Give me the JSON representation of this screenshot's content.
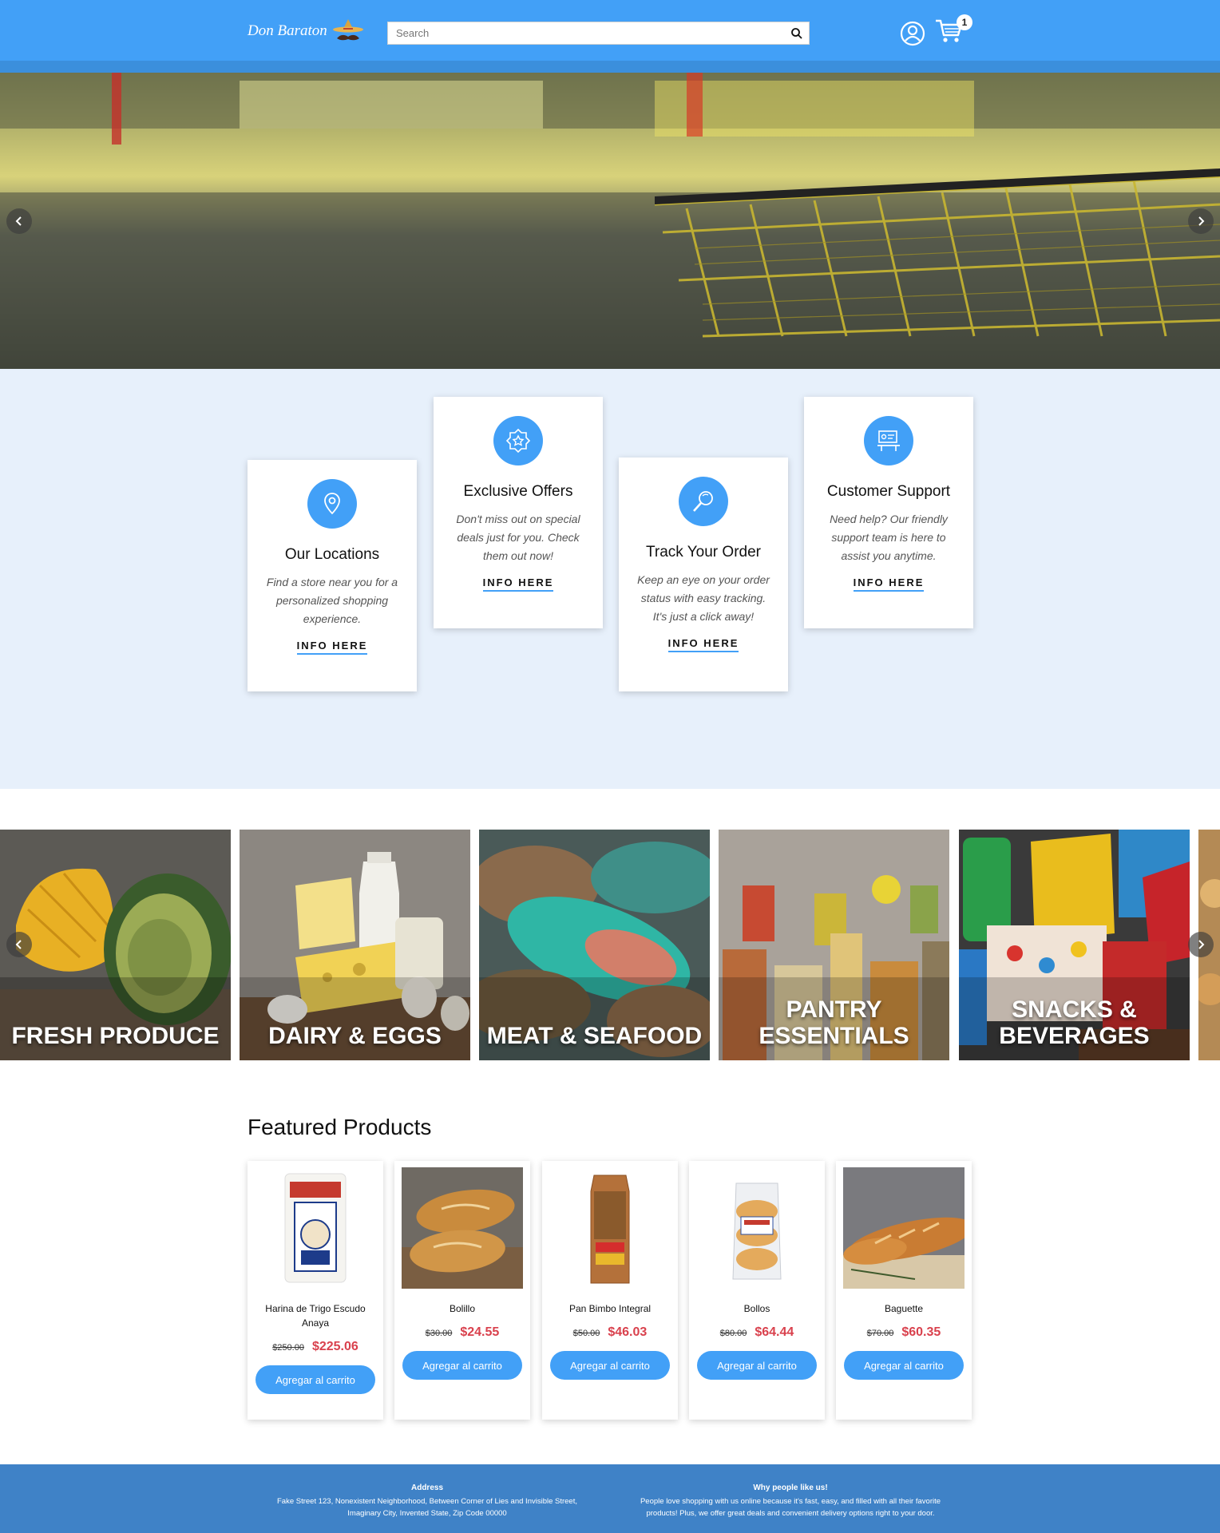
{
  "header": {
    "logo_text": "Don Baraton",
    "search_placeholder": "Search",
    "cart_count": "1"
  },
  "services": [
    {
      "title": "Our Locations",
      "description": "Find a store near you for a personalized shopping experience.",
      "link": "INFO HERE",
      "icon": "location-pin-icon"
    },
    {
      "title": "Exclusive Offers",
      "description": "Don't miss out on special deals just for you. Check them out now!",
      "link": "INFO HERE",
      "icon": "badge-icon"
    },
    {
      "title": "Track Your Order",
      "description": "Keep an eye on your order status with easy tracking. It's just a click away!",
      "link": "INFO HERE",
      "icon": "magnifier-icon"
    },
    {
      "title": "Customer Support",
      "description": "Need help? Our friendly support team is here to assist you anytime.",
      "link": "INFO HERE",
      "icon": "support-desk-icon"
    }
  ],
  "categories": [
    {
      "label": "FRESH PRODUCE"
    },
    {
      "label": "DAIRY & EGGS"
    },
    {
      "label": "MEAT & SEAFOOD"
    },
    {
      "label": "PANTRY ESSENTIALS"
    },
    {
      "label": "SNACKS & BEVERAGES"
    }
  ],
  "featured": {
    "title": "Featured Products",
    "products": [
      {
        "name": "Harina de Trigo Escudo Anaya",
        "old_price": "$250.00",
        "price": "$225.06",
        "button": "Agregar al carrito"
      },
      {
        "name": "Bolillo",
        "old_price": "$30.00",
        "price": "$24.55",
        "button": "Agregar al carrito"
      },
      {
        "name": "Pan Bimbo Integral",
        "old_price": "$50.00",
        "price": "$46.03",
        "button": "Agregar al carrito"
      },
      {
        "name": "Bollos",
        "old_price": "$80.00",
        "price": "$64.44",
        "button": "Agregar al carrito"
      },
      {
        "name": "Baguette",
        "old_price": "$70.00",
        "price": "$60.35",
        "button": "Agregar al carrito"
      }
    ]
  },
  "footer": {
    "address_title": "Address",
    "address_text": "Fake Street 123, Nonexistent Neighborhood, Between Corner of Lies and Invisible Street, Imaginary City, Invented State, Zip Code 00000",
    "why_title": "Why people like us!",
    "why_text": "People love shopping with us online because it's fast, easy, and filled with all their favorite products! Plus, we offer great deals and convenient delivery options right to your door."
  }
}
